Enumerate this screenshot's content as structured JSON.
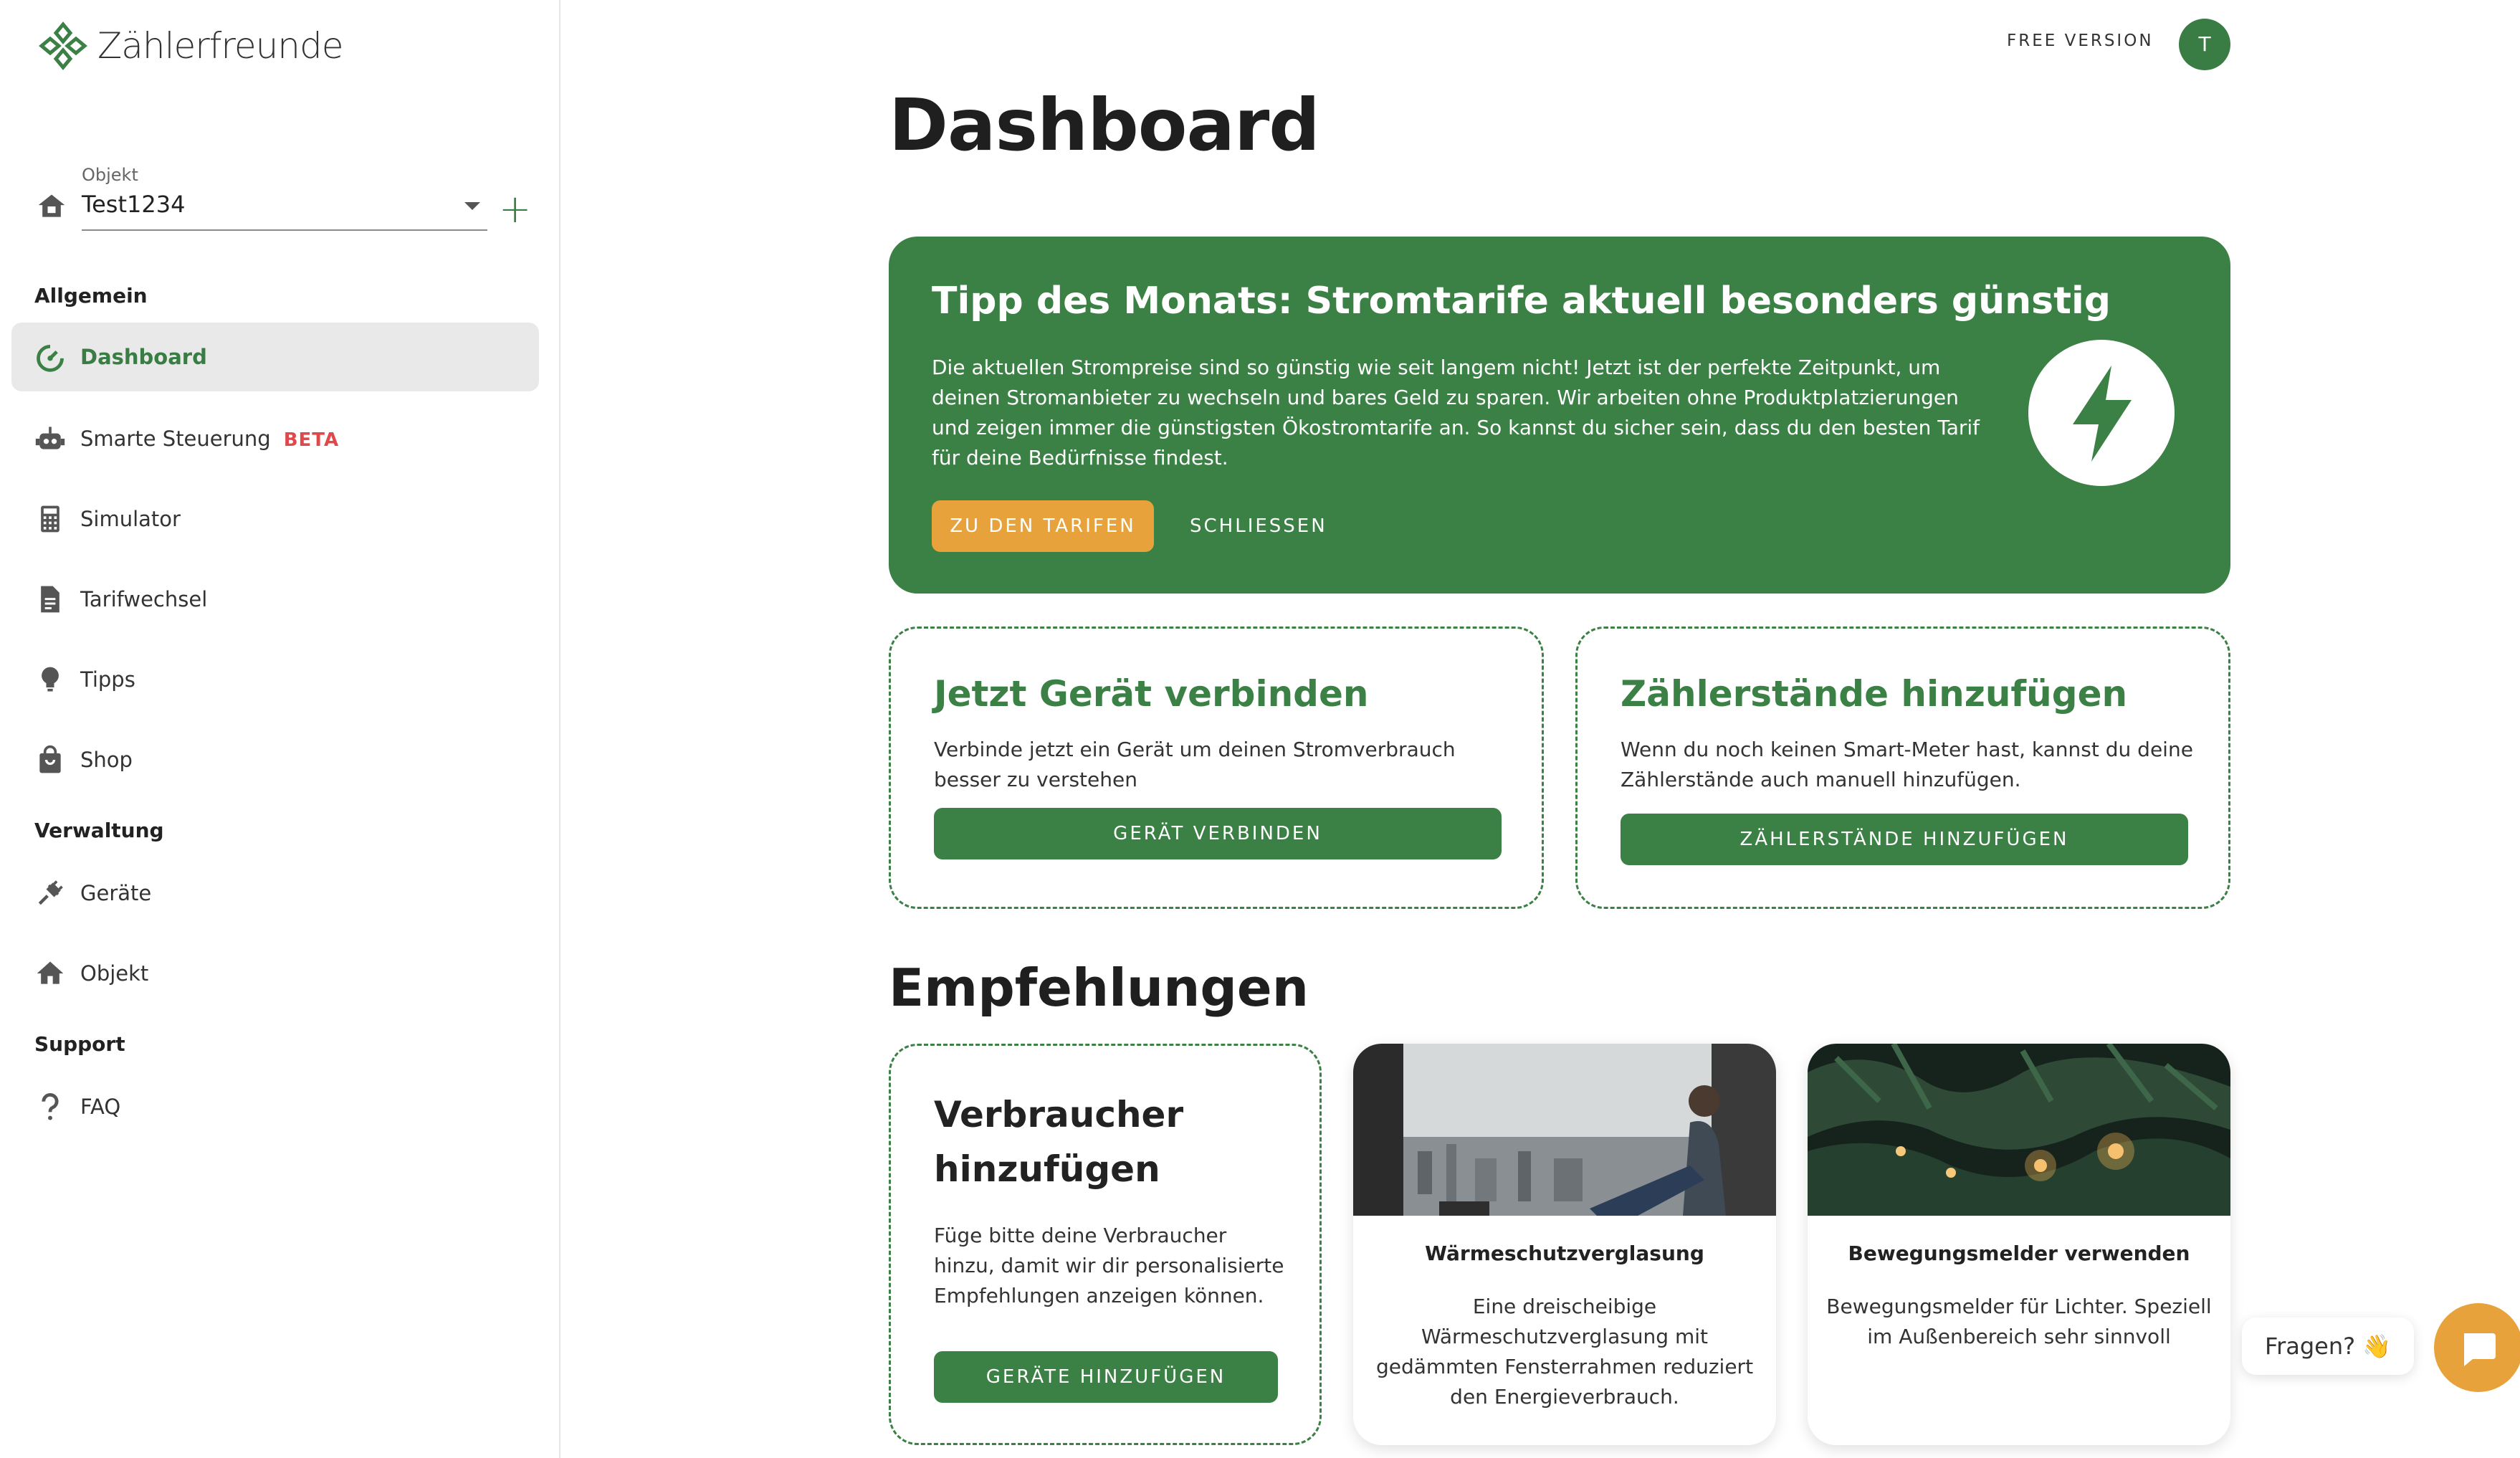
{
  "app": {
    "name": "Zählerfreunde",
    "brand_color": "#3b8044",
    "accent_color": "#e8a23b"
  },
  "sidebar": {
    "object_label": "Objekt",
    "object_value": "Test1234",
    "sections": {
      "general": "Allgemein",
      "management": "Verwaltung",
      "support": "Support"
    },
    "items": [
      {
        "label": "Dashboard",
        "icon": "speedometer-icon",
        "active": true
      },
      {
        "label": "Smarte Steuerung",
        "icon": "robot-icon",
        "badge": "BETA"
      },
      {
        "label": "Simulator",
        "icon": "calculator-icon"
      },
      {
        "label": "Tarifwechsel",
        "icon": "document-icon"
      },
      {
        "label": "Tipps",
        "icon": "lightbulb-icon"
      },
      {
        "label": "Shop",
        "icon": "shopping-bag-icon"
      },
      {
        "label": "Geräte",
        "icon": "plug-icon"
      },
      {
        "label": "Objekt",
        "icon": "home-icon"
      },
      {
        "label": "FAQ",
        "icon": "question-icon"
      }
    ]
  },
  "header": {
    "plan": "FREE VERSION",
    "avatar_initial": "T"
  },
  "main": {
    "title": "Dashboard",
    "tip": {
      "title": "Tipp des Monats: Stromtarife aktuell besonders günstig",
      "text": "Die aktuellen Strompreise sind so günstig wie seit langem nicht! Jetzt ist der perfekte Zeitpunkt, um deinen Stromanbieter zu wechseln und bares Geld zu sparen. Wir arbeiten ohne Produktplatzierungen und zeigen immer die günstigsten Ökostromtarife an. So kannst du sicher sein, dass du den besten Tarif für deine Bedürfnisse findest.",
      "primary_button": "ZU DEN TARIFEN",
      "close_button": "SCHLIESSEN",
      "icon": "lightning-icon"
    },
    "connect_card": {
      "title": "Jetzt Gerät verbinden",
      "text": "Verbinde jetzt ein Gerät um deinen Stromverbrauch besser zu verstehen",
      "button": "GERÄT VERBINDEN"
    },
    "readings_card": {
      "title": "Zählerstände hinzufügen",
      "text": "Wenn du noch keinen Smart-Meter hast, kannst du deine Zählerstände auch manuell hinzufügen.",
      "button": "ZÄHLERSTÄNDE HINZUFÜGEN"
    },
    "recommendations": {
      "title": "Empfehlungen",
      "consumer_card": {
        "title": "Verbraucher hinzufügen",
        "text": "Füge bitte deine Verbraucher hinzu, damit wir dir personalisierte Empfehlungen anzeigen können.",
        "button": "GERÄTE HINZUFÜGEN"
      },
      "items": [
        {
          "title": "Wärmeschutzverglasung",
          "text": "Eine dreischeibige Wärmeschutzverglasung mit gedämmten Fensterrahmen reduziert den Energieverbrauch.",
          "image": "window-photo"
        },
        {
          "title": "Bewegungsmelder verwenden",
          "text": "Bewegungsmelder für Lichter. Speziell im Außenbereich sehr sinnvoll",
          "image": "lights-photo"
        }
      ]
    }
  },
  "chat": {
    "label": "Fragen? 👋",
    "icon": "chat-icon"
  }
}
